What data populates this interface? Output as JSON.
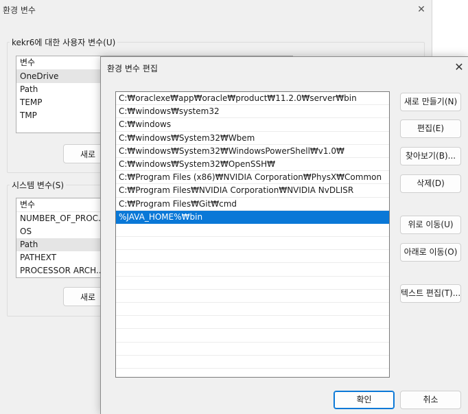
{
  "background_window": {
    "title": "환경 변수",
    "close_glyph": "✕",
    "user_group": {
      "legend": "kekr6에 대한 사용자 변수(U)",
      "header": "변수",
      "rows": [
        "OneDrive",
        "Path",
        "TEMP",
        "TMP"
      ],
      "selected_index": 0,
      "new_button": "새로"
    },
    "system_group": {
      "legend": "시스템 변수(S)",
      "header": "변수",
      "rows": [
        "NUMBER_OF_PROC...",
        "OS",
        "Path",
        "PATHEXT",
        "PROCESSOR ARCH..."
      ],
      "selected_index": 2,
      "new_button": "새로"
    }
  },
  "dialog": {
    "title": "환경 변수 편집",
    "close_glyph": "✕",
    "paths": [
      "C:₩oraclexe₩app₩oracle₩product₩11.2.0₩server₩bin",
      "C:₩windows₩system32",
      "C:₩windows",
      "C:₩windows₩System32₩Wbem",
      "C:₩windows₩System32₩WindowsPowerShell₩v1.0₩",
      "C:₩windows₩System32₩OpenSSH₩",
      "C:₩Program Files (x86)₩NVIDIA Corporation₩PhysX₩Common",
      "C:₩Program Files₩NVIDIA Corporation₩NVIDIA NvDLISR",
      "C:₩Program Files₩Git₩cmd",
      "%JAVA_HOME%₩bin"
    ],
    "selected_index": 9,
    "empty_rows": 12,
    "buttons": {
      "new": "새로 만들기(N)",
      "edit": "편집(E)",
      "browse": "찾아보기(B)...",
      "delete": "삭제(D)",
      "move_up": "위로 이동(U)",
      "move_down": "아래로 이동(O)",
      "edit_text": "텍스트 편집(T)...",
      "ok": "확인",
      "cancel": "취소"
    }
  },
  "colors": {
    "selection": "#0a78d7",
    "window_bg": "#f0f0f0"
  }
}
